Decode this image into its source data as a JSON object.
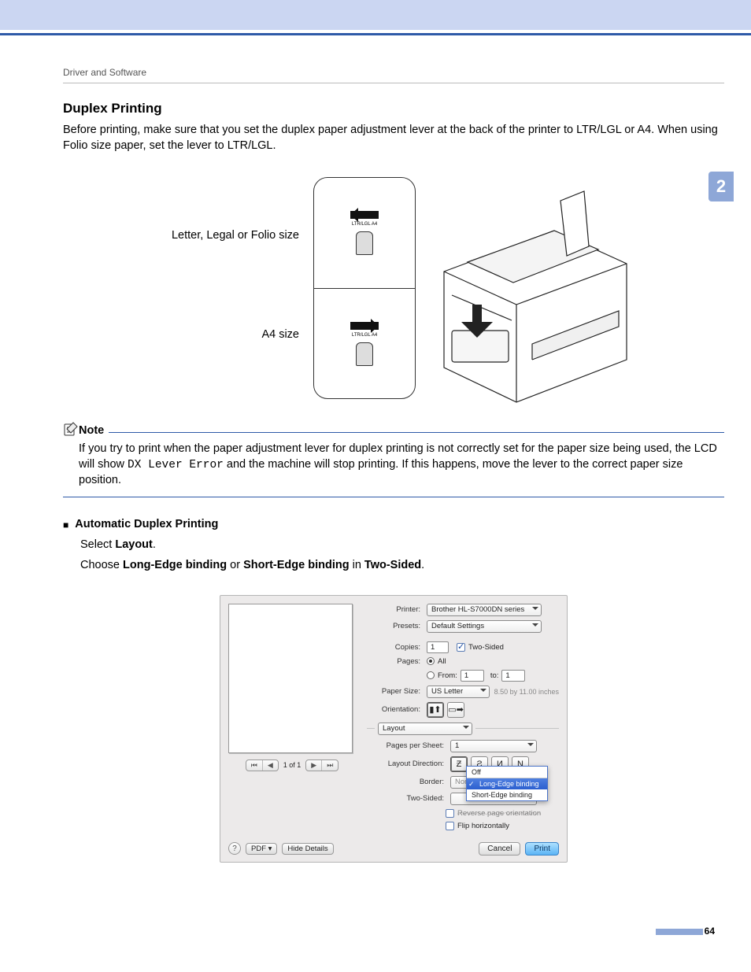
{
  "breadcrumb": "Driver and Software",
  "chapter_tab": "2",
  "heading": "Duplex Printing",
  "intro": "Before printing, make sure that you set the duplex paper adjustment lever at the back of the printer to LTR/LGL or A4. When using Folio size paper, set the lever to LTR/LGL.",
  "lever": {
    "label1": "Letter, Legal or Folio size",
    "label2": "A4 size",
    "panel_text": "LTR/LGL A4"
  },
  "note": {
    "title": "Note",
    "body_pre": "If you try to print when the paper adjustment lever for duplex printing is not correctly set for the paper size being used, the LCD will show ",
    "code": "DX Lever Error",
    "body_post": " and the machine will stop printing. If this happens, move the lever to the correct paper size position."
  },
  "auto": {
    "heading": "Automatic Duplex Printing",
    "line1_pre": "Select ",
    "line1_b": "Layout",
    "line1_post": ".",
    "line2_a": "Choose ",
    "line2_b": "Long-Edge binding",
    "line2_c": " or ",
    "line2_d": "Short-Edge binding",
    "line2_e": " in ",
    "line2_f": "Two-Sided",
    "line2_g": "."
  },
  "dialog": {
    "printer_lbl": "Printer:",
    "printer_val": "Brother HL-S7000DN series",
    "presets_lbl": "Presets:",
    "presets_val": "Default Settings",
    "copies_lbl": "Copies:",
    "copies_val": "1",
    "twosided_chk": "Two-Sided",
    "pages_lbl": "Pages:",
    "pages_all": "All",
    "from_lbl": "From:",
    "from_val": "1",
    "to_lbl": "to:",
    "to_val": "1",
    "papersize_lbl": "Paper Size:",
    "papersize_val": "US Letter",
    "papersize_dim": "8.50 by 11.00 inches",
    "orient_lbl": "Orientation:",
    "section": "Layout",
    "pps_lbl": "Pages per Sheet:",
    "pps_val": "1",
    "ldir_lbl": "Layout Direction:",
    "border_lbl": "Border:",
    "border_val": "None",
    "twosided_lbl": "Two-Sided:",
    "dd_off": "Off",
    "dd_long": "Long-Edge binding",
    "dd_short": "Short-Edge binding",
    "revpage": "Reverse page orientation",
    "flip": "Flip horizontally",
    "pager": "1 of 1",
    "help": "?",
    "pdf": "PDF",
    "hide": "Hide Details",
    "cancel": "Cancel",
    "print": "Print"
  },
  "page_number": "64"
}
